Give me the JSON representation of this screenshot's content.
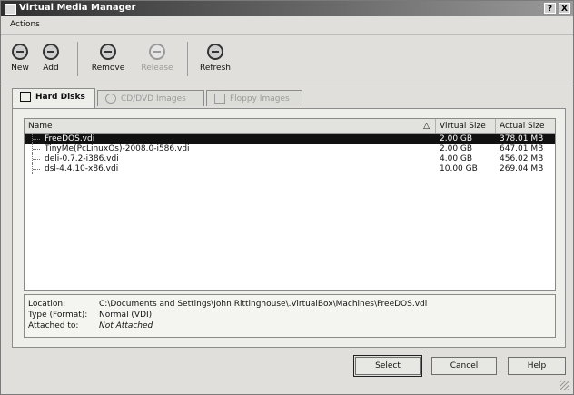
{
  "window": {
    "title": "Virtual Media Manager",
    "help_btn": "?",
    "close_btn": "X"
  },
  "menu": {
    "actions": "Actions"
  },
  "toolbar": {
    "new": "New",
    "add": "Add",
    "remove": "Remove",
    "release": "Release",
    "refresh": "Refresh",
    "icons": {
      "new": "new-disk-icon",
      "add": "add-disk-icon",
      "remove": "remove-disk-icon",
      "release": "release-disk-icon",
      "refresh": "refresh-icon"
    }
  },
  "tabs": {
    "hard_disks": "Hard Disks",
    "cd_dvd": "CD/DVD Images",
    "floppy": "Floppy Images"
  },
  "table": {
    "columns": {
      "name": "Name",
      "virtual_size": "Virtual Size",
      "actual_size": "Actual Size"
    },
    "rows": [
      {
        "name": "FreeDOS.vdi",
        "virtual_size": "2.00 GB",
        "actual_size": "378.01 MB"
      },
      {
        "name": "TinyMe(PcLinuxOs)-2008.0-i586.vdi",
        "virtual_size": "2.00 GB",
        "actual_size": "647.01 MB"
      },
      {
        "name": "deli-0.7.2-i386.vdi",
        "virtual_size": "4.00 GB",
        "actual_size": "456.02 MB"
      },
      {
        "name": "dsl-4.4.10-x86.vdi",
        "virtual_size": "10.00 GB",
        "actual_size": "269.04 MB"
      }
    ]
  },
  "details": {
    "location_label": "Location:",
    "location": "C:\\Documents and Settings\\John Rittinghouse\\.VirtualBox\\Machines\\FreeDOS.vdi",
    "type_label": "Type (Format):",
    "type": "Normal (VDI)",
    "attached_label": "Attached to:",
    "attached": "Not Attached"
  },
  "buttons": {
    "select": "Select",
    "cancel": "Cancel",
    "help": "Help"
  }
}
